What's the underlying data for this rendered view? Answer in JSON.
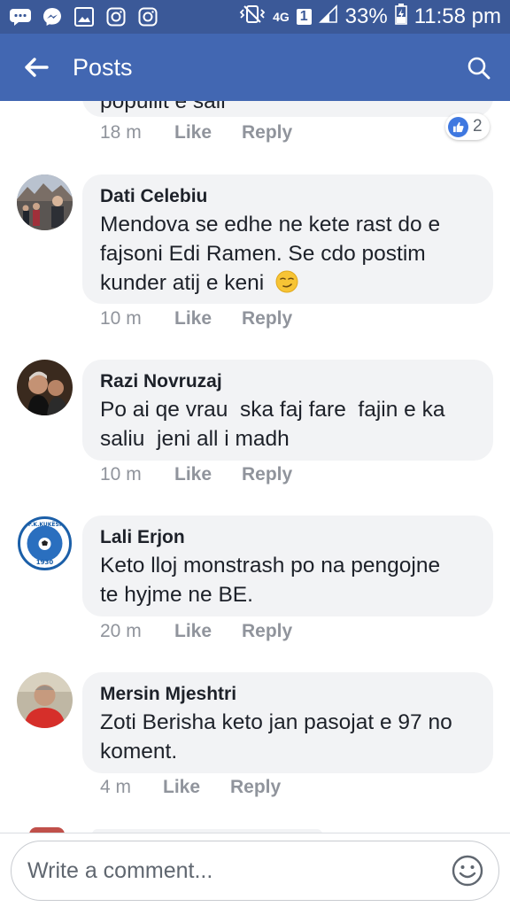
{
  "status_bar": {
    "network": "4G",
    "sim": "1",
    "battery": "33%",
    "time": "11:58 pm"
  },
  "appbar": {
    "title": "Posts"
  },
  "comments": [
    {
      "author": "",
      "text": "popullit e sali",
      "time": "18 m",
      "like": "Like",
      "reply": "Reply",
      "reactions": "2"
    },
    {
      "author": "Dati Celebiu",
      "lines": [
        "Mendova se edhe ne kete rast do e",
        "fajsoni Edi Ramen. Se cdo postim",
        "kunder atij e keni"
      ],
      "emoji": "smirk",
      "time": "10 m",
      "like": "Like",
      "reply": "Reply"
    },
    {
      "author": "Razi Novruzaj",
      "lines": [
        "Po ai qe vrau  ska faj fare  fajin e ka",
        "saliu  jeni all i madh"
      ],
      "time": "10 m",
      "like": "Like",
      "reply": "Reply"
    },
    {
      "author": "Lali Erjon",
      "lines": [
        "Keto lloj monstrash po na pengojne",
        "te hyjme ne BE."
      ],
      "time": "20 m",
      "like": "Like",
      "reply": "Reply",
      "avatar_text": "F.K.KUKËSI",
      "avatar_year": "1930"
    },
    {
      "author": "Mersin Mjeshtri",
      "lines": [
        "Zoti Berisha keto jan pasojat e 97 no",
        "koment."
      ],
      "time": "4 m",
      "like": "Like",
      "reply": "Reply"
    }
  ],
  "composer": {
    "placeholder": "Write a comment..."
  },
  "colors": {
    "status_bar": "#3b5998",
    "app_bar": "#4267b2",
    "bubble": "#f2f3f5",
    "like_blue": "#3f78e0"
  }
}
